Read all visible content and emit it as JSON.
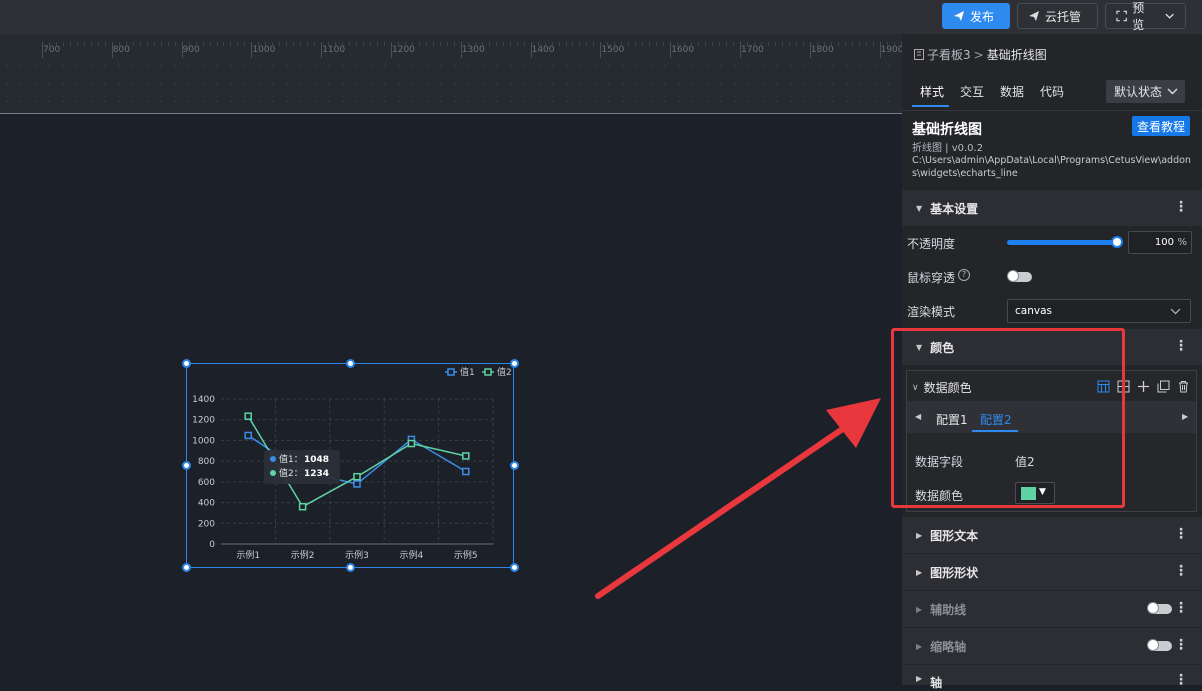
{
  "topbar": {
    "publish_label": "发布",
    "cloud_label": "云托管",
    "preview_label": "预览"
  },
  "ruler": {
    "ticks": [
      "700",
      "800",
      "900",
      "1000",
      "1100",
      "1200",
      "1300",
      "1400",
      "1500",
      "1600",
      "1700",
      "1800",
      "1900"
    ]
  },
  "breadcrumb": {
    "parent": "子看板3",
    "separator": ">",
    "current": "基础折线图"
  },
  "panel_tabs": [
    "样式",
    "交互",
    "数据",
    "代码"
  ],
  "state_select": "默认状态",
  "component": {
    "title": "基础折线图",
    "subtitle": "折线图 | v0.0.2",
    "path": "C:\\Users\\admin\\AppData\\Local\\Programs\\CetusView\\addons\\widgets\\echarts_line",
    "tutorial_label": "查看教程"
  },
  "basic": {
    "title": "基本设置",
    "opacity_label": "不透明度",
    "opacity_value": "100",
    "opacity_unit": "%",
    "opacity_level": 100,
    "mouse_through_label": "鼠标穿透",
    "mouse_through_help": "?",
    "render_label": "渲染模式",
    "render_value": "canvas"
  },
  "color": {
    "title": "颜色",
    "data_color_title": "数据颜色",
    "tab1": "配置1",
    "tab2": "配置2",
    "field_label": "数据字段",
    "field_value": "值2",
    "color_label": "数据颜色",
    "swatch": "#5fd3a3"
  },
  "sections": {
    "text": "图形文本",
    "shape": "图形形状",
    "aux": "辅助线",
    "scale": "缩略轴",
    "axis": "轴"
  },
  "chart_data": {
    "type": "line",
    "categories": [
      "示例1",
      "示例2",
      "示例3",
      "示例4",
      "示例5"
    ],
    "series": [
      {
        "name": "值1",
        "values": [
          1048,
          700,
          580,
          1010,
          700
        ],
        "color": "#3b8de8"
      },
      {
        "name": "值2",
        "values": [
          1234,
          360,
          650,
          970,
          850
        ],
        "color": "#5fd3a3"
      }
    ],
    "ylim": [
      0,
      1400
    ],
    "yticks": [
      "0",
      "200",
      "400",
      "600",
      "800",
      "1000",
      "1200",
      "1400"
    ],
    "grid": true,
    "legend": "top-right",
    "tooltip": {
      "items": [
        {
          "name": "值1",
          "value": "1048"
        },
        {
          "name": "值2",
          "value": "1234"
        }
      ]
    }
  }
}
